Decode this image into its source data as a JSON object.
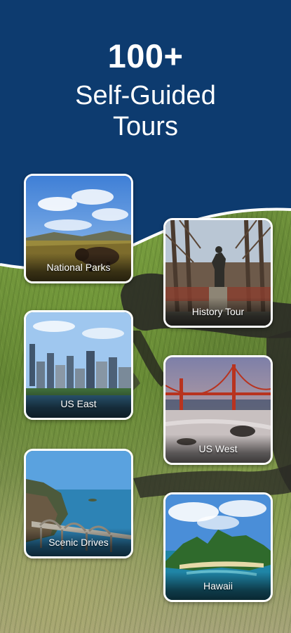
{
  "header": {
    "count": "100+",
    "subtitle_line1": "Self-Guided",
    "subtitle_line2": "Tours",
    "bg_color": "#0d3b6f"
  },
  "tours": [
    {
      "label": "National Parks"
    },
    {
      "label": "History Tour"
    },
    {
      "label": "US East"
    },
    {
      "label": "US West"
    },
    {
      "label": "Scenic Drives"
    },
    {
      "label": "Hawaii"
    }
  ]
}
